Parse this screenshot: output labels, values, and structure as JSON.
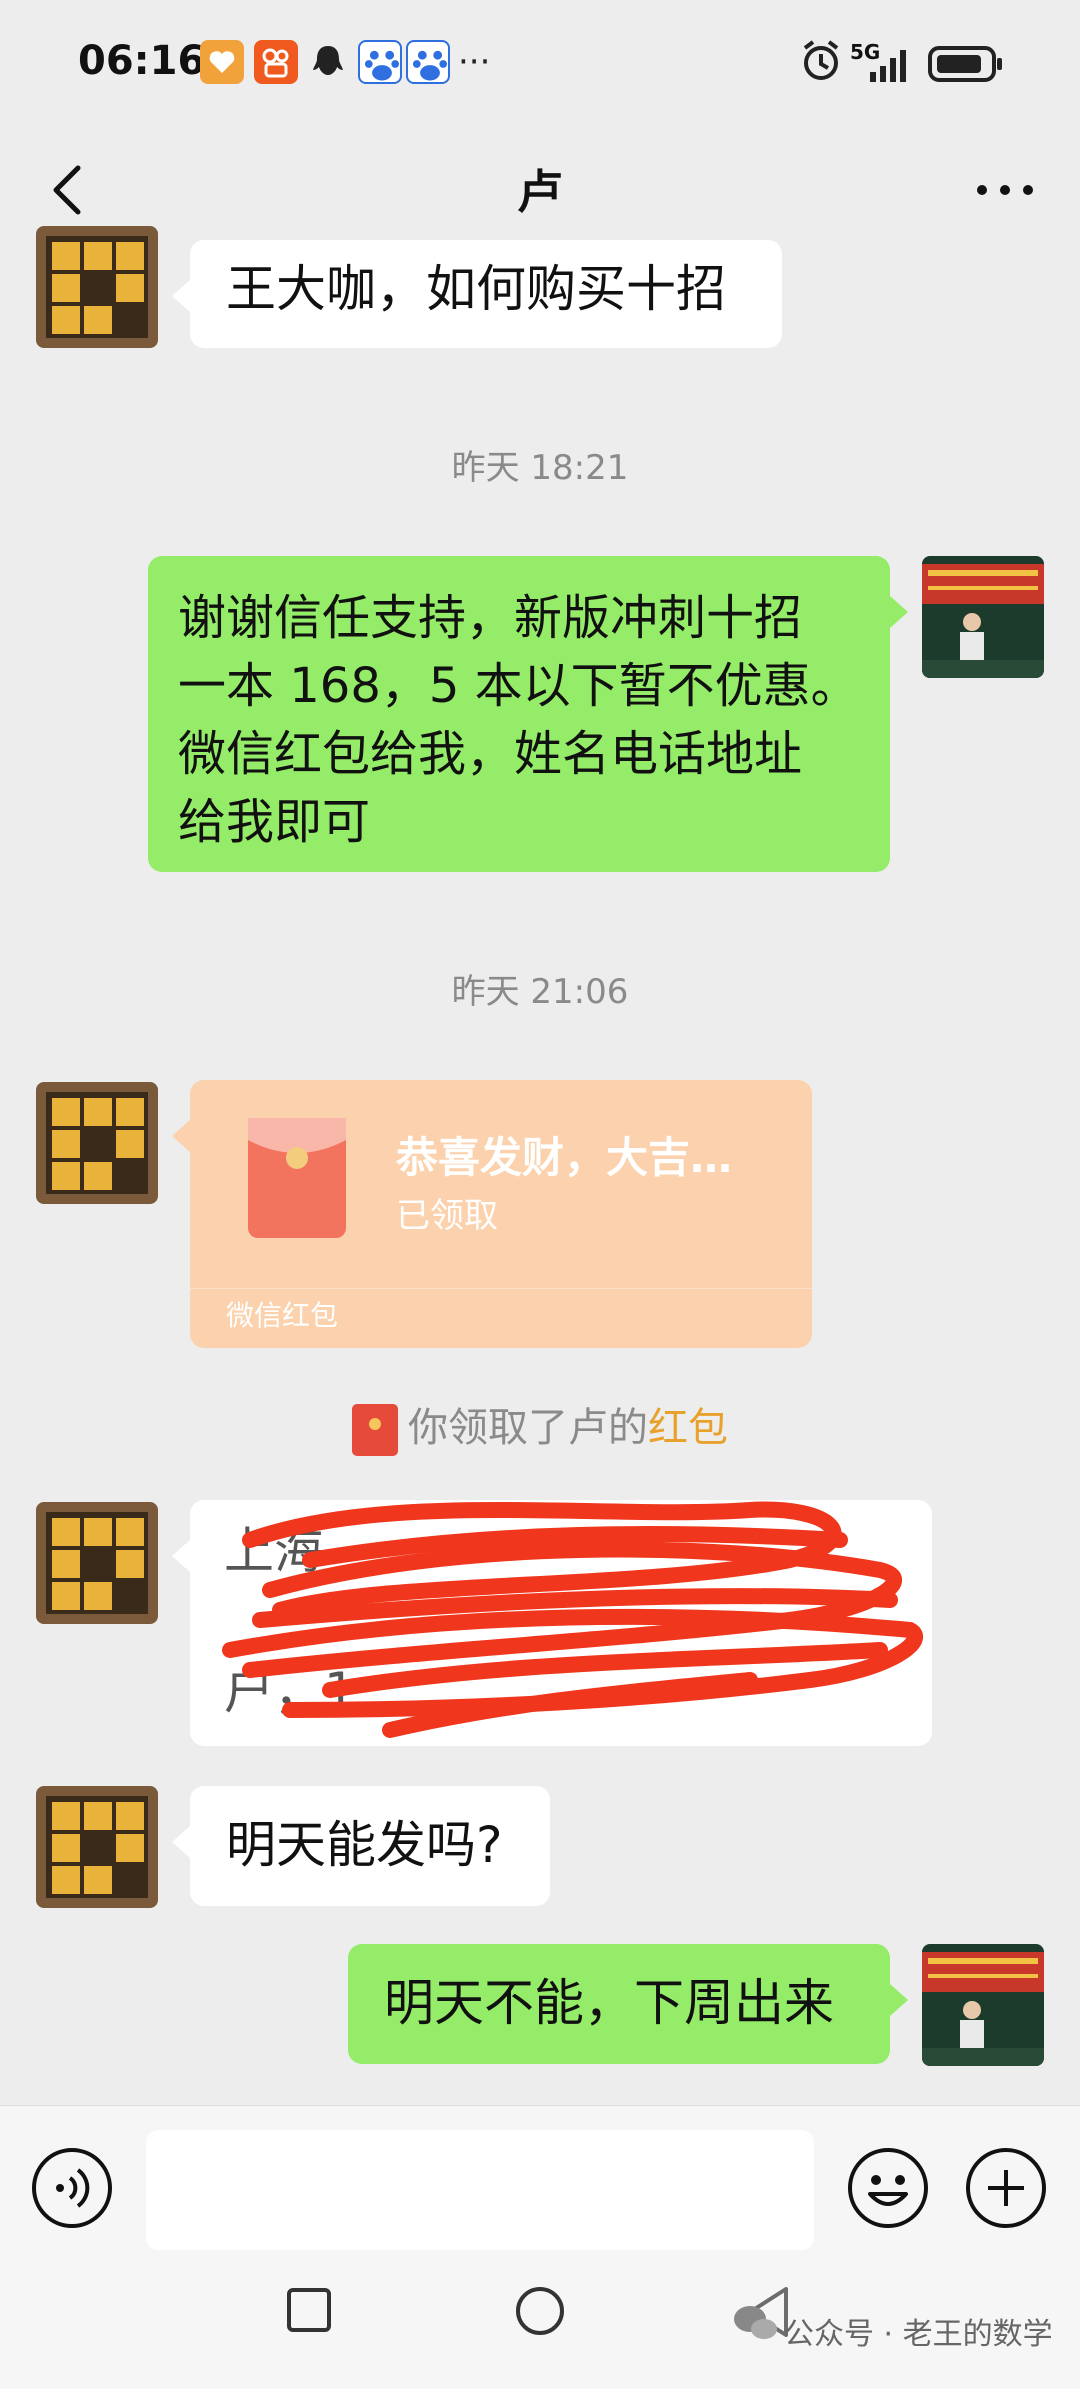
{
  "status_bar": {
    "time": "06:16",
    "network": "5G",
    "icons": [
      "heart-app-icon",
      "kuaishou-icon",
      "qq-icon",
      "baidu-icon",
      "baidu-icon",
      "more-dots",
      "alarm-icon",
      "signal-icon",
      "battery-icon"
    ],
    "overflow": "···"
  },
  "header": {
    "title": "卢"
  },
  "messages": [
    {
      "text": "王大咖，如何购买十招"
    },
    {
      "timestamp": "昨天 18:21"
    },
    {
      "text": "谢谢信任支持，新版冲刺十招一本 168，5 本以下暂不优惠。微信红包给我，姓名电话地址给我即可",
      "lines": [
        "谢谢信任支持，新版冲刺十招",
        "一本 168，5 本以下暂不优惠。",
        "微信红包给我，姓名电话地址",
        "给我即可"
      ]
    },
    {
      "timestamp": "昨天 21:06"
    },
    {
      "red_packet": {
        "title": "恭喜发财，大吉…",
        "status": "已领取",
        "footer": "微信红包"
      }
    },
    {
      "notice": {
        "prefix": "你领取了卢的",
        "highlight": "红包"
      }
    },
    {
      "redacted_lines": [
        "上海",
        "",
        "户，1"
      ]
    },
    {
      "text": "明天能发吗?"
    },
    {
      "text": "明天不能，下周出来"
    }
  ],
  "watermark": "公众号 · 老王的数学",
  "colors": {
    "background": "#ededed",
    "self_bubble": "#95ec69",
    "other_bubble": "#ffffff",
    "packet": "#fbd2ad",
    "redaction": "#f0361c",
    "highlight": "#e8a12c"
  }
}
